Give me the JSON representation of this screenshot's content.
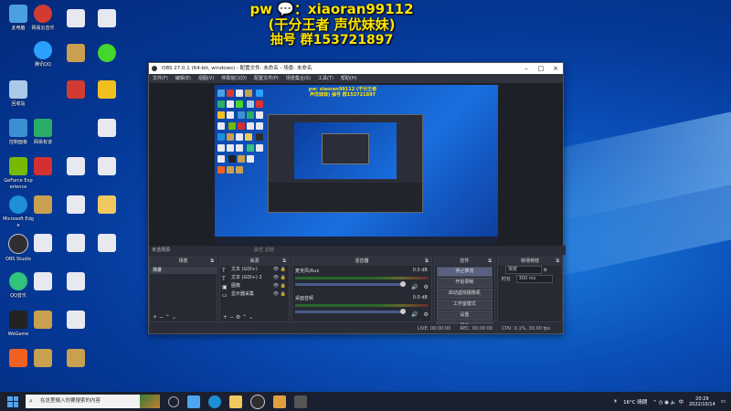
{
  "overlay": {
    "line1": "pw 💬：xiaoran99112",
    "line2": "(干分王者 声优妹妹)",
    "line3": "抽号 群153721897"
  },
  "desktop_icons": [
    {
      "label": "此电脑",
      "color": "#4aa0e0"
    },
    {
      "label": "腾讯QQ",
      "color": "#2aa0ff"
    },
    {
      "label": "回收站",
      "color": "#aac8e8"
    },
    {
      "label": "控制面板",
      "color": "#3a90d0"
    },
    {
      "label": "GeForce Experience",
      "color": "#76b900"
    },
    {
      "label": "Microsoft Edge",
      "color": "#1e8fd8"
    },
    {
      "label": "OBS Studio",
      "color": "#302e31"
    },
    {
      "label": "QQ音乐",
      "color": "#31c27c"
    },
    {
      "label": "WeGame",
      "color": "#222222"
    },
    {
      "label": "网易云音乐",
      "color": "#d33a31"
    },
    {
      "label": "网易有道",
      "color": "#e03030"
    }
  ],
  "obs": {
    "title": "OBS 27.0.1 (64-bit, windows) - 配置文件: 未命名 - 场景: 未命名",
    "menu": [
      "文件(F)",
      "编辑(E)",
      "视图(V)",
      "停靠窗口(D)",
      "配置文件(P)",
      "场景集合(S)",
      "工具(T)",
      "帮助(H)"
    ],
    "preview_overlay": "pw: xiaoran99112 (干分王者 声优妹妹) 抽号 群153721897",
    "status_line": "未选择源",
    "status_small": "属性   滤镜",
    "docks": {
      "scenes": {
        "title": "场景",
        "items": [
          "场景"
        ]
      },
      "sources": {
        "title": "来源",
        "items": [
          {
            "icon": "T",
            "label": "文本 (GDI+)"
          },
          {
            "icon": "T",
            "label": "文本 (GDI+) 2"
          },
          {
            "icon": "▣",
            "label": "图像"
          },
          {
            "icon": "▭",
            "label": "显示器采集"
          }
        ]
      },
      "mixer": {
        "title": "混音器",
        "tracks": [
          {
            "name": "麦克风/Aux",
            "db": "0.0 dB"
          },
          {
            "name": "桌面音频",
            "db": "0.0 dB"
          }
        ]
      },
      "controls": {
        "title": "控件",
        "buttons": [
          "停止推流",
          "开始录制",
          "启动虚拟摄像机",
          "工作室模式",
          "设置",
          "退出"
        ]
      },
      "transitions": {
        "title": "转场特效",
        "type": "渐变",
        "duration_label": "时长",
        "duration_value": "300 ms"
      }
    },
    "statusbar": {
      "live": "LIVE: 00:00:00",
      "rec": "REC: 00:00:00",
      "cpu": "CPU: 0.1%, 30.00 fps"
    }
  },
  "taskbar": {
    "search_placeholder": "在这里输入你要搜索的内容",
    "weather": "16°C 晴朗",
    "time": "20:29",
    "date": "2022/10/14"
  }
}
